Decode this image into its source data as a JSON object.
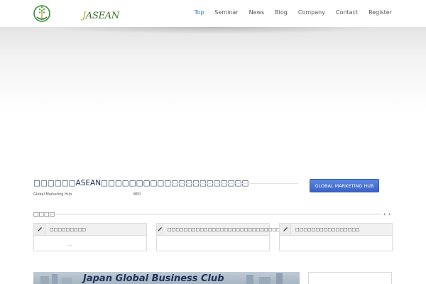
{
  "header": {
    "logo_text_accent": "J",
    "logo_text_rest": "ASEAN",
    "nav": [
      {
        "label": "Top",
        "active": true
      },
      {
        "label": "Seminar",
        "active": false
      },
      {
        "label": "News",
        "active": false
      },
      {
        "label": "Blog",
        "active": false
      },
      {
        "label": "Company",
        "active": false
      },
      {
        "label": "Contact",
        "active": false
      },
      {
        "label": "Register",
        "active": false
      }
    ]
  },
  "intro": {
    "title": "□□□□□□ASEAN□□□□□□□□□□□□□□□□□□□□□",
    "sub_left": "Global Marketing Hub",
    "sub_right": "BPO",
    "button_label": "GLOBAL MARKETING HUB"
  },
  "news": {
    "title": "□□□□",
    "prev_label": "‹",
    "next_label": "›",
    "cards": [
      {
        "title": "□□□□□□□□□",
        "body": "..."
      },
      {
        "title": "□□□□□□□□□□□□□□□□□□□□□□□□□□□□□",
        "body": ""
      },
      {
        "title": "□□□□□□□□□□□□□□□□",
        "body": ""
      }
    ]
  },
  "banner": {
    "text": "Japan Global Business Club"
  },
  "colors": {
    "nav_active": "#2d73c4",
    "button": "#3a63c6",
    "logo_green": "#3a6e2c",
    "logo_gold": "#c8a22a"
  }
}
